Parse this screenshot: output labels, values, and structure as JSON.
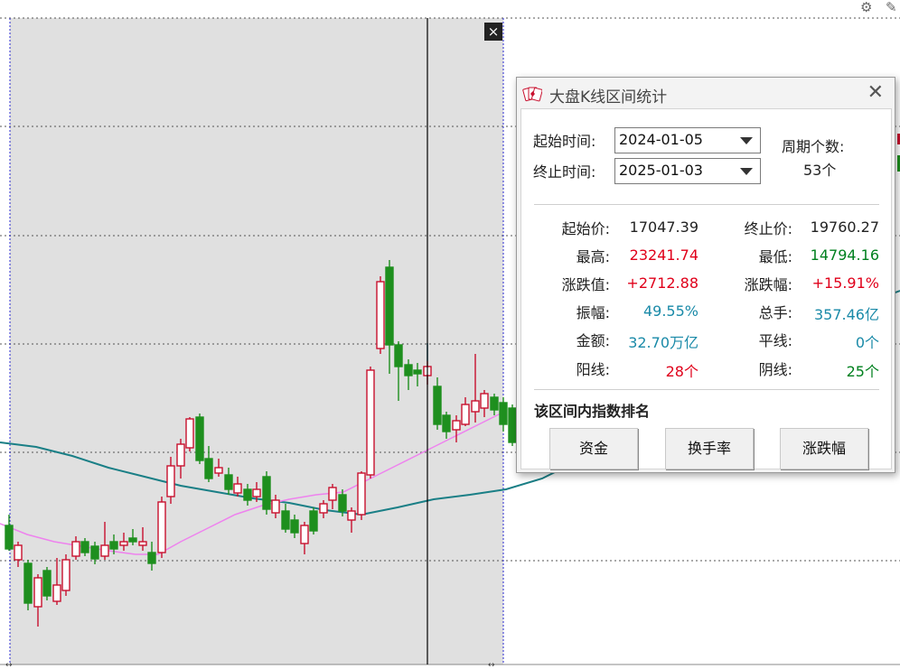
{
  "dialog": {
    "title": "大盘K线区间统计",
    "start_label": "起始时间:",
    "start_value": "2024-01-05",
    "end_label": "终止时间:",
    "end_value": "2025-01-03",
    "period_label": "周期个数:",
    "period_value": "53个",
    "stats": {
      "start_price_label": "起始价:",
      "start_price": "17047.39",
      "end_price_label": "终止价:",
      "end_price": "19760.27",
      "high_label": "最高:",
      "high": "23241.74",
      "low_label": "最低:",
      "low": "14794.16",
      "change_label": "涨跌值:",
      "change": "+2712.88",
      "change_pct_label": "涨跌幅:",
      "change_pct": "+15.91%",
      "amplitude_label": "振幅:",
      "amplitude": "49.55%",
      "volume_label": "总手:",
      "volume": "357.46亿",
      "amount_label": "金额:",
      "amount": "32.70万亿",
      "flat_label": "平线:",
      "flat": "0个",
      "up_label": "阳线:",
      "up": "28个",
      "down_label": "阴线:",
      "down": "25个"
    },
    "rank_title": "该区间内指数排名",
    "buttons": [
      "资金",
      "换手率",
      "涨跌幅"
    ],
    "colors": {
      "up": "#e0001a",
      "down": "#00801e",
      "neutral": "#1a8aa8",
      "text": "#222222"
    }
  },
  "chart": {
    "close_label": "×",
    "candle_up_color": "#c8102e",
    "candle_down_color": "#1e8f1e",
    "ma_short_color": "#ee82ee",
    "ma_long_color": "#1a7f86",
    "selection_color": "#e0e0e0"
  },
  "icons": [
    "gear-icon",
    "pencil-icon",
    "app-cards-icon",
    "close-icon"
  ]
}
